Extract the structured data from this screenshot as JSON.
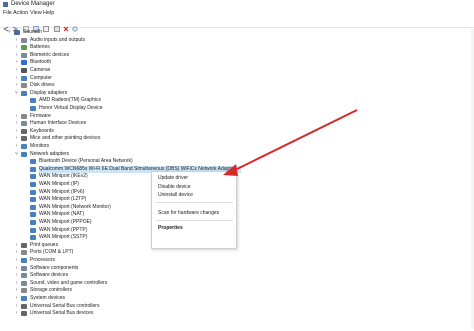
{
  "window": {
    "title": "Device Manager"
  },
  "menu": [
    "File",
    "Action",
    "View",
    "Help"
  ],
  "toolbar": [
    "back-icon",
    "forward-icon",
    "properties-icon",
    "help-icon",
    "update-icon",
    "disable-icon",
    "uninstall-icon",
    "scan-icon"
  ],
  "tree": [
    {
      "label": "Saurabh",
      "level": 0,
      "chev": "v",
      "color": "#4a6b9b"
    },
    {
      "label": "Audio inputs and outputs",
      "level": 1,
      "chev": ">",
      "color": "#7a8a99"
    },
    {
      "label": "Batteries",
      "level": 1,
      "chev": ">",
      "color": "#5a9e4a"
    },
    {
      "label": "Biometric devices",
      "level": 1,
      "chev": ">",
      "color": "#7a8a99"
    },
    {
      "label": "Bluetooth",
      "level": 1,
      "chev": ">",
      "color": "#2f6fd6"
    },
    {
      "label": "Cameras",
      "level": 1,
      "chev": ">",
      "color": "#555555"
    },
    {
      "label": "Computer",
      "level": 1,
      "chev": ">",
      "color": "#4a80c0"
    },
    {
      "label": "Disk drives",
      "level": 1,
      "chev": ">",
      "color": "#888888"
    },
    {
      "label": "Display adapters",
      "level": 1,
      "chev": "v",
      "color": "#4a80c0"
    },
    {
      "label": "AMD Radeon(TM) Graphics",
      "level": 2,
      "chev": "",
      "color": "#4a80c0"
    },
    {
      "label": "Honor Virtual Display Device",
      "level": 2,
      "chev": "",
      "color": "#4a80c0"
    },
    {
      "label": "Firmware",
      "level": 1,
      "chev": ">",
      "color": "#888888"
    },
    {
      "label": "Human Interface Devices",
      "level": 1,
      "chev": ">",
      "color": "#7a8a99"
    },
    {
      "label": "Keyboards",
      "level": 1,
      "chev": ">",
      "color": "#666666"
    },
    {
      "label": "Mice and other pointing devices",
      "level": 1,
      "chev": ">",
      "color": "#666666"
    },
    {
      "label": "Monitors",
      "level": 1,
      "chev": ">",
      "color": "#4a80c0"
    },
    {
      "label": "Network adapters",
      "level": 1,
      "chev": "v",
      "color": "#4a80c0"
    },
    {
      "label": "Bluetooth Device (Personal Area Network)",
      "level": 2,
      "chev": "",
      "color": "#4a80c0"
    },
    {
      "label": "Qualcomm WCN685x Wi-Fi 6E Dual Band Simultaneous (DBS) WiFiCx Network Adapter",
      "level": 2,
      "chev": "",
      "color": "#4a80c0",
      "selected": true
    },
    {
      "label": "WAN Miniport (IKEv2)",
      "level": 2,
      "chev": "",
      "color": "#4a80c0"
    },
    {
      "label": "WAN Miniport (IP)",
      "level": 2,
      "chev": "",
      "color": "#4a80c0"
    },
    {
      "label": "WAN Miniport (IPv6)",
      "level": 2,
      "chev": "",
      "color": "#4a80c0"
    },
    {
      "label": "WAN Miniport (L2TP)",
      "level": 2,
      "chev": "",
      "color": "#4a80c0"
    },
    {
      "label": "WAN Miniport (Network Monitor)",
      "level": 2,
      "chev": "",
      "color": "#4a80c0"
    },
    {
      "label": "WAN Miniport (NAT)",
      "level": 2,
      "chev": "",
      "color": "#4a80c0"
    },
    {
      "label": "WAN Miniport (PPPOE)",
      "level": 2,
      "chev": "",
      "color": "#4a80c0"
    },
    {
      "label": "WAN Miniport (PPTP)",
      "level": 2,
      "chev": "",
      "color": "#4a80c0"
    },
    {
      "label": "WAN Miniport (SSTP)",
      "level": 2,
      "chev": "",
      "color": "#4a80c0"
    },
    {
      "label": "Print queues",
      "level": 1,
      "chev": ">",
      "color": "#666666"
    },
    {
      "label": "Ports (COM & LPT)",
      "level": 1,
      "chev": ">",
      "color": "#888888"
    },
    {
      "label": "Processors",
      "level": 1,
      "chev": ">",
      "color": "#4a80c0"
    },
    {
      "label": "Software components",
      "level": 1,
      "chev": ">",
      "color": "#7a8a99"
    },
    {
      "label": "Software devices",
      "level": 1,
      "chev": ">",
      "color": "#7a8a99"
    },
    {
      "label": "Sound, video and game controllers",
      "level": 1,
      "chev": ">",
      "color": "#7a8a99"
    },
    {
      "label": "Storage controllers",
      "level": 1,
      "chev": ">",
      "color": "#888888"
    },
    {
      "label": "System devices",
      "level": 1,
      "chev": ">",
      "color": "#4a80c0"
    },
    {
      "label": "Universal Serial Bus controllers",
      "level": 1,
      "chev": ">",
      "color": "#666666"
    },
    {
      "label": "Universal Serial Bus devices",
      "level": 1,
      "chev": ">",
      "color": "#666666"
    }
  ],
  "context_menu": {
    "update": "Update driver",
    "disable": "Disable device",
    "uninstall": "Uninstall device",
    "scan": "Scan for hardware changes",
    "properties": "Properties"
  },
  "colors": {
    "arrow": "#d42a2a",
    "selection": "#cde4f7"
  }
}
